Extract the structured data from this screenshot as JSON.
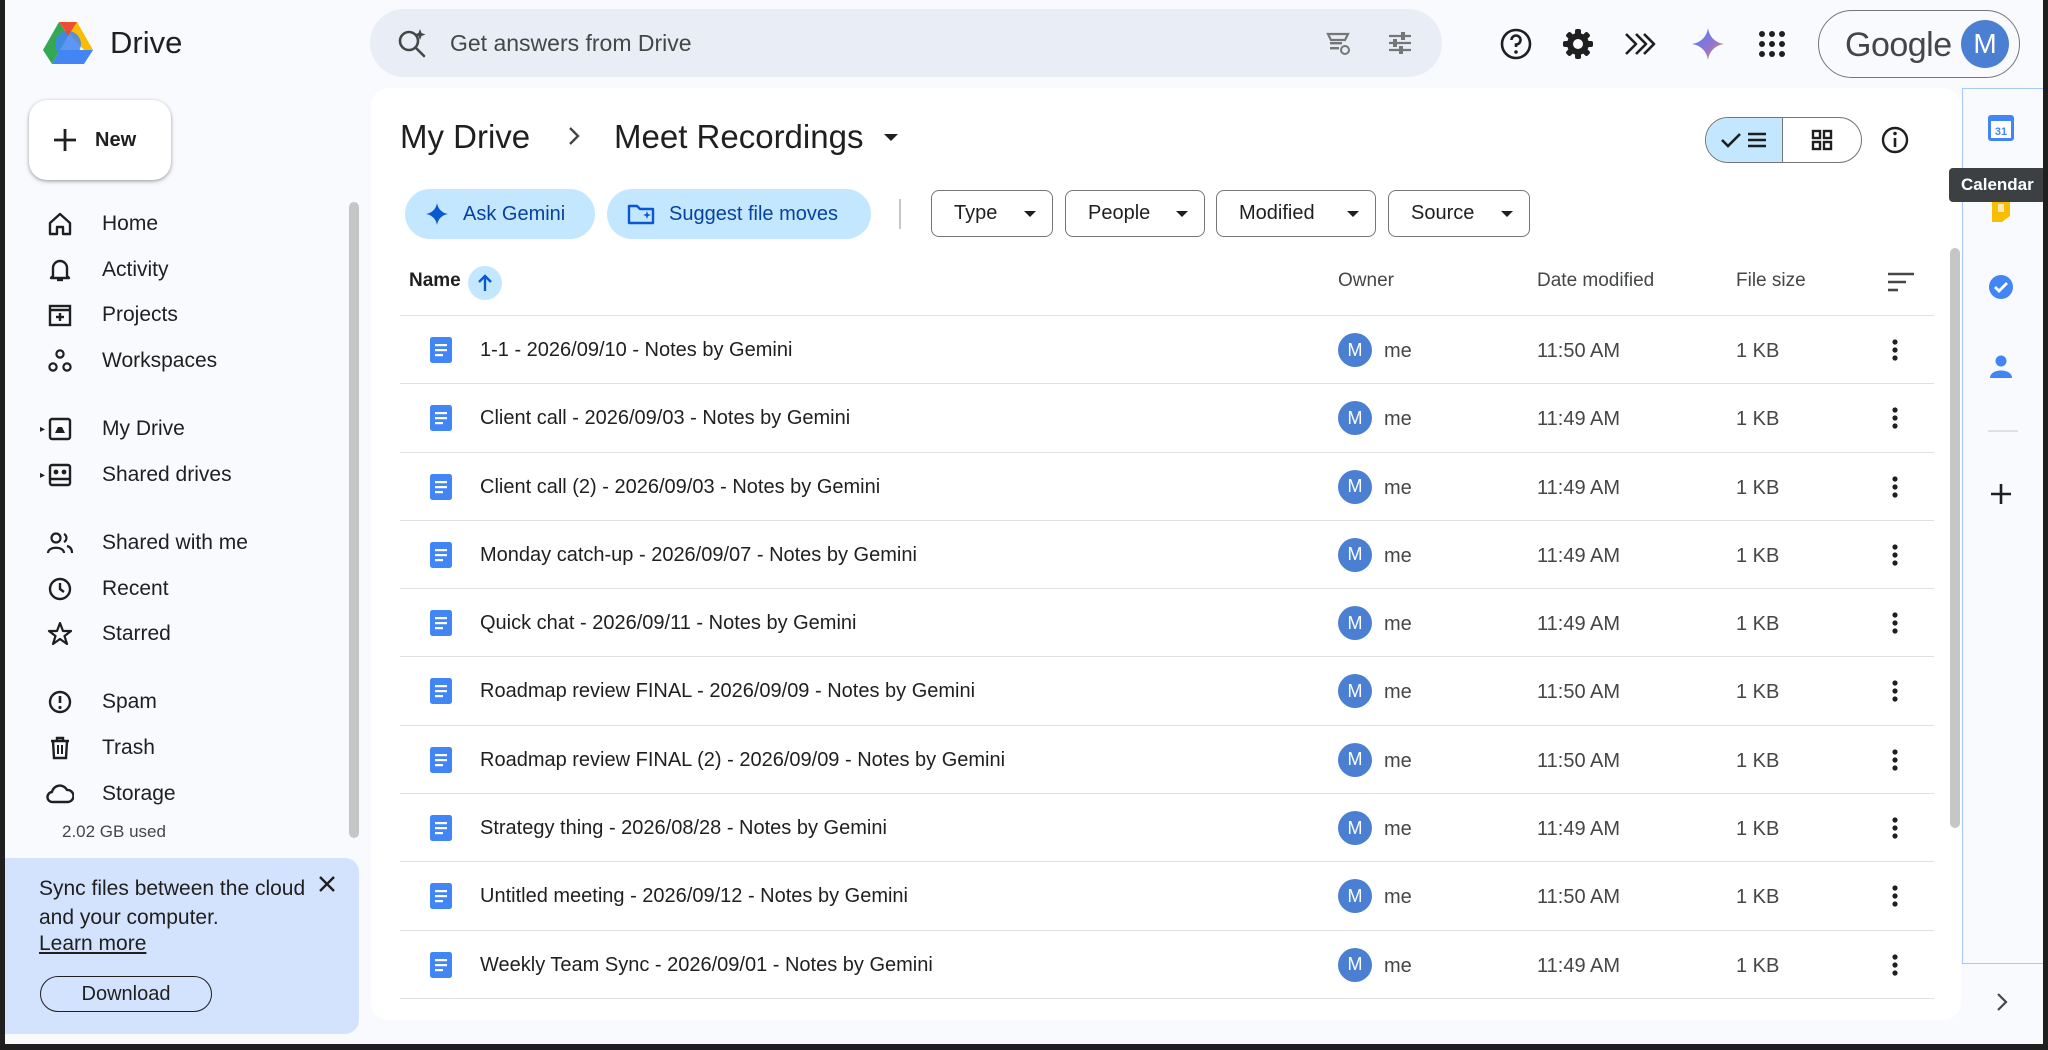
{
  "app": {
    "name": "Drive"
  },
  "search": {
    "placeholder": "Get answers from Drive"
  },
  "account": {
    "brand": "Google",
    "initial": "M"
  },
  "sidebar": {
    "new_label": "New",
    "items": [
      {
        "label": "Home",
        "icon": "home-icon"
      },
      {
        "label": "Activity",
        "icon": "bell-icon"
      },
      {
        "label": "Projects",
        "icon": "projects-icon"
      },
      {
        "label": "Workspaces",
        "icon": "workspaces-icon"
      },
      {
        "label": "My Drive",
        "icon": "my-drive-icon"
      },
      {
        "label": "Shared drives",
        "icon": "shared-drives-icon"
      },
      {
        "label": "Shared with me",
        "icon": "people-icon"
      },
      {
        "label": "Recent",
        "icon": "clock-icon"
      },
      {
        "label": "Starred",
        "icon": "star-icon"
      },
      {
        "label": "Spam",
        "icon": "spam-icon"
      },
      {
        "label": "Trash",
        "icon": "trash-icon"
      },
      {
        "label": "Storage",
        "icon": "cloud-icon"
      }
    ],
    "storage_used": "2.02 GB used",
    "sync_card": {
      "text": "Sync files between the cloud and your computer.",
      "learn_more": "Learn more",
      "download": "Download"
    }
  },
  "breadcrumb": {
    "root": "My Drive",
    "current": "Meet Recordings"
  },
  "toolbar": {
    "ask_gemini": "Ask Gemini",
    "suggest_moves": "Suggest file moves",
    "filters": [
      "Type",
      "People",
      "Modified",
      "Source"
    ]
  },
  "table": {
    "headers": {
      "name": "Name",
      "owner": "Owner",
      "modified": "Date modified",
      "size": "File size"
    },
    "rows": [
      {
        "name": "1-1 - 2026/09/10 - Notes by Gemini",
        "owner": "me",
        "initial": "M",
        "modified": "11:50 AM",
        "size": "1 KB"
      },
      {
        "name": "Client call - 2026/09/03 - Notes by Gemini",
        "owner": "me",
        "initial": "M",
        "modified": "11:49 AM",
        "size": "1 KB"
      },
      {
        "name": "Client call (2) - 2026/09/03 - Notes by Gemini",
        "owner": "me",
        "initial": "M",
        "modified": "11:49 AM",
        "size": "1 KB"
      },
      {
        "name": "Monday catch-up - 2026/09/07 - Notes by Gemini",
        "owner": "me",
        "initial": "M",
        "modified": "11:49 AM",
        "size": "1 KB"
      },
      {
        "name": "Quick chat - 2026/09/11 - Notes by Gemini",
        "owner": "me",
        "initial": "M",
        "modified": "11:49 AM",
        "size": "1 KB"
      },
      {
        "name": "Roadmap review FINAL - 2026/09/09 - Notes by Gemini",
        "owner": "me",
        "initial": "M",
        "modified": "11:50 AM",
        "size": "1 KB"
      },
      {
        "name": "Roadmap review FINAL (2) - 2026/09/09 - Notes by Gemini",
        "owner": "me",
        "initial": "M",
        "modified": "11:50 AM",
        "size": "1 KB"
      },
      {
        "name": "Strategy thing - 2026/08/28 - Notes by Gemini",
        "owner": "me",
        "initial": "M",
        "modified": "11:49 AM",
        "size": "1 KB"
      },
      {
        "name": "Untitled meeting - 2026/09/12 - Notes by Gemini",
        "owner": "me",
        "initial": "M",
        "modified": "11:50 AM",
        "size": "1 KB"
      },
      {
        "name": "Weekly Team Sync - 2026/09/01 - Notes by Gemini",
        "owner": "me",
        "initial": "M",
        "modified": "11:49 AM",
        "size": "1 KB"
      }
    ]
  },
  "side_panel": {
    "calendar_tooltip": "Calendar",
    "calendar_day": "31"
  },
  "colors": {
    "accent": "#0b57d0",
    "chip": "#c2e7ff",
    "avatar": "#4a7fd2",
    "doc": "#4285f4"
  }
}
